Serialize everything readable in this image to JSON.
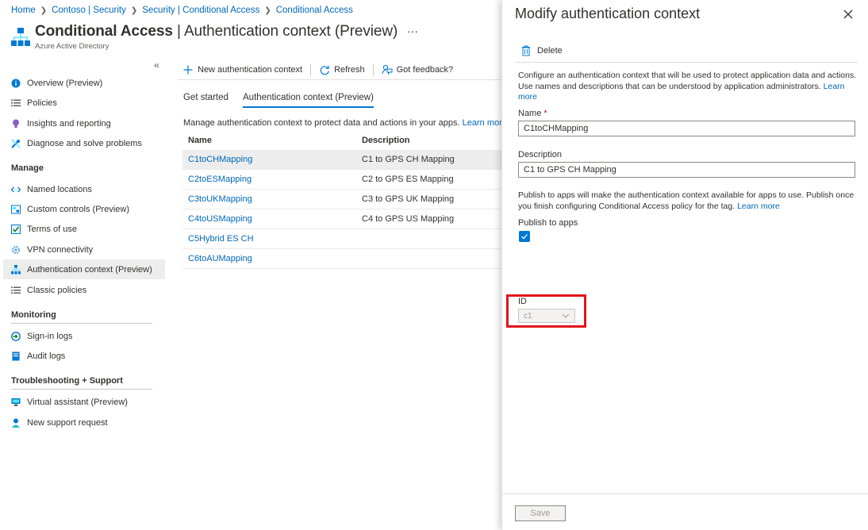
{
  "breadcrumb": [
    "Home",
    "Contoso | Security",
    "Security | Conditional Access",
    "Conditional Access"
  ],
  "header": {
    "title_strong": "Conditional Access",
    "title_sep": " | ",
    "title_light": "Authentication context (Preview)",
    "more": "···",
    "subtitle": "Azure Active Directory"
  },
  "sidebar": {
    "collapse": "«",
    "items_top": [
      {
        "label": "Overview (Preview)",
        "icon": "info-icon"
      },
      {
        "label": "Policies",
        "icon": "list-icon"
      },
      {
        "label": "Insights and reporting",
        "icon": "bulb-icon"
      },
      {
        "label": "Diagnose and solve problems",
        "icon": "tools-icon"
      }
    ],
    "section_manage": "Manage",
    "items_manage": [
      {
        "label": "Named locations",
        "icon": "arrows-icon"
      },
      {
        "label": "Custom controls (Preview)",
        "icon": "controls-icon"
      },
      {
        "label": "Terms of use",
        "icon": "checklist-icon"
      },
      {
        "label": "VPN connectivity",
        "icon": "gear-icon"
      },
      {
        "label": "Authentication context (Preview)",
        "icon": "network-icon"
      },
      {
        "label": "Classic policies",
        "icon": "list-icon"
      }
    ],
    "section_monitoring": "Monitoring",
    "items_monitoring": [
      {
        "label": "Sign-in logs",
        "icon": "signin-icon"
      },
      {
        "label": "Audit logs",
        "icon": "book-icon"
      }
    ],
    "section_support": "Troubleshooting + Support",
    "items_support": [
      {
        "label": "Virtual assistant (Preview)",
        "icon": "assistant-icon"
      },
      {
        "label": "New support request",
        "icon": "person-icon"
      }
    ]
  },
  "toolbar": {
    "new_label": "New authentication context",
    "refresh_label": "Refresh",
    "feedback_label": "Got feedback?"
  },
  "tabs": [
    "Get started",
    "Authentication context (Preview)"
  ],
  "main": {
    "intro": "Manage authentication context to protect data and actions in your apps.",
    "learn_more": "Learn more"
  },
  "table": {
    "headers": [
      "Name",
      "Description"
    ],
    "rows": [
      {
        "name": "C1toCHMapping",
        "description": "C1 to GPS CH Mapping"
      },
      {
        "name": "C2toESMapping",
        "description": "C2 to GPS ES Mapping"
      },
      {
        "name": "C3toUKMapping",
        "description": "C3 to GPS UK Mapping"
      },
      {
        "name": "C4toUSMapping",
        "description": "C4 to GPS US Mapping"
      },
      {
        "name": "C5Hybrid ES CH",
        "description": ""
      },
      {
        "name": "C6toAUMapping",
        "description": ""
      }
    ]
  },
  "panel": {
    "title": "Modify authentication context",
    "delete_label": "Delete",
    "intro": "Configure an authentication context that will be used to protect application data and actions. Use names and descriptions that can be understood by application administrators.",
    "learn_more": "Learn more",
    "name_label": "Name",
    "required_mark": "*",
    "name_value": "C1toCHMapping",
    "description_label": "Description",
    "description_value": "C1 to GPS CH Mapping",
    "publish_text": "Publish to apps will make the authentication context available for apps to use. Publish once you finish configuring Conditional Access policy for the tag.",
    "publish_learn_more": "Learn more",
    "publish_label": "Publish to apps",
    "publish_checked": true,
    "id_label": "ID",
    "id_value": "c1",
    "save_label": "Save"
  },
  "colors": {
    "accent": "#0078d4",
    "link": "#0067b8",
    "highlight": "#e3141b"
  }
}
